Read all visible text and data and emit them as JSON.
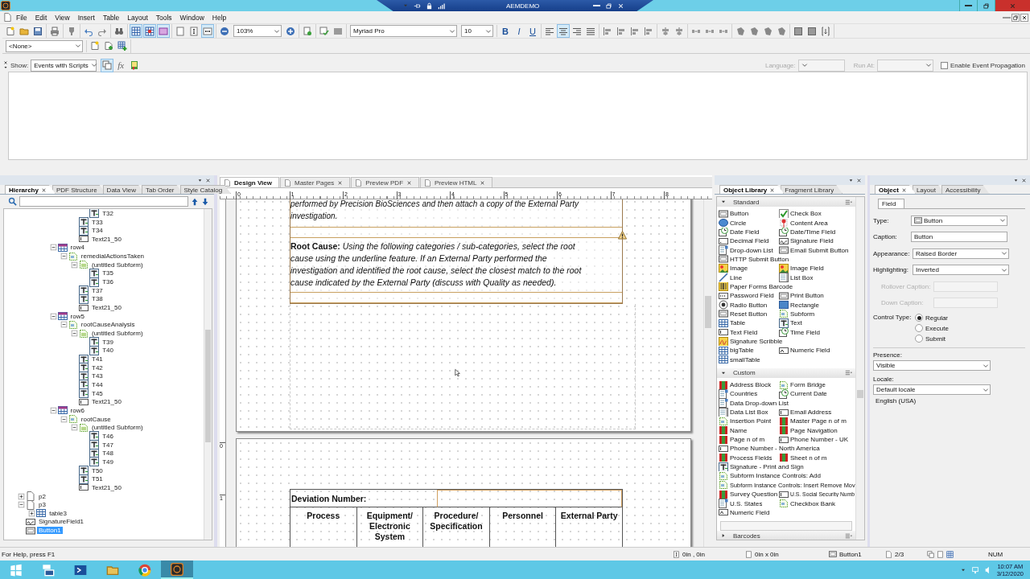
{
  "title_bar": {
    "session_label": "AEMDEMO"
  },
  "menu": [
    "File",
    "Edit",
    "View",
    "Insert",
    "Table",
    "Layout",
    "Tools",
    "Window",
    "Help"
  ],
  "toolbar": [
    [
      {
        "kind": "new",
        "pressed": false
      },
      {
        "kind": "open",
        "pressed": false
      },
      {
        "kind": "save",
        "pressed": false
      }
    ],
    [
      {
        "kind": "print",
        "pressed": false
      }
    ],
    [
      {
        "kind": "stamp",
        "pressed": false
      }
    ],
    [
      {
        "kind": "undo",
        "pressed": false
      },
      {
        "kind": "redo",
        "pressed": false
      }
    ],
    [
      {
        "kind": "find",
        "pressed": false
      }
    ],
    [
      {
        "kind": "grid",
        "pressed": true
      },
      {
        "kind": "snap",
        "pressed": true
      },
      {
        "kind": "guides",
        "pressed": true
      }
    ],
    [
      {
        "kind": "page",
        "pressed": false
      },
      {
        "kind": "vfit",
        "pressed": false
      },
      {
        "kind": "hfit",
        "pressed": true
      }
    ],
    [
      {
        "kind": "zoom-out",
        "pressed": false
      },
      {
        "kind": "zoom-select",
        "value": "103%"
      },
      {
        "kind": "zoom-in",
        "pressed": false
      }
    ],
    [
      {
        "kind": "preview",
        "pressed": false
      }
    ],
    [
      {
        "kind": "spell",
        "pressed": false
      },
      {
        "kind": "disabled-box",
        "pressed": false
      }
    ],
    [
      {
        "kind": "font-select",
        "value": "Myriad Pro"
      },
      {
        "kind": "size-select",
        "value": "10"
      }
    ],
    [
      {
        "kind": "bold",
        "label": "B",
        "pressed": false
      },
      {
        "kind": "italic",
        "label": "I",
        "pressed": false
      },
      {
        "kind": "underline",
        "label": "U",
        "pressed": false
      }
    ],
    [
      {
        "kind": "align-left",
        "pressed": false
      },
      {
        "kind": "align-center",
        "pressed": true
      },
      {
        "kind": "align-right",
        "pressed": false
      },
      {
        "kind": "justify",
        "pressed": false
      }
    ],
    [
      {
        "kind": "edge",
        "pressed": false
      },
      {
        "kind": "edge",
        "pressed": false
      },
      {
        "kind": "edge",
        "pressed": false
      },
      {
        "kind": "edge",
        "pressed": false
      }
    ],
    [
      {
        "kind": "mid",
        "pressed": false
      },
      {
        "kind": "mid",
        "pressed": false
      }
    ],
    [
      {
        "kind": "distribute",
        "pressed": false
      },
      {
        "kind": "distribute",
        "pressed": false
      },
      {
        "kind": "distribute",
        "pressed": false
      }
    ],
    [
      {
        "kind": "rotate",
        "pressed": false
      },
      {
        "kind": "rotate",
        "pressed": false
      },
      {
        "kind": "rotate",
        "pressed": false
      },
      {
        "kind": "rotate",
        "pressed": false
      }
    ],
    [
      {
        "kind": "resize",
        "pressed": false
      },
      {
        "kind": "resize",
        "pressed": false
      },
      {
        "kind": "order",
        "pressed": false
      }
    ]
  ],
  "toolbar2": [
    [
      {
        "kind": "style-select",
        "value": "<None>"
      }
    ],
    [
      {
        "kind": "form-new",
        "pressed": false
      },
      {
        "kind": "form-add",
        "pressed": false
      },
      {
        "kind": "table-add",
        "pressed": false
      }
    ]
  ],
  "script_editor": {
    "show_label": "Show:",
    "show_value": "Events with Scripts",
    "tools": [
      {
        "kind": "events",
        "pressed": true
      },
      {
        "kind": "function",
        "label": "fx",
        "pressed": false
      },
      {
        "kind": "book",
        "pressed": false
      }
    ],
    "language_label": "Language:",
    "run_at_label": "Run At:",
    "propagation": {
      "label": "Enable Event Propagation",
      "checked": false
    }
  },
  "hierarchy": {
    "tabs": [
      {
        "label": "Hierarchy",
        "selected": true
      },
      {
        "label": "PDF Structure",
        "selected": false
      },
      {
        "label": "Data View",
        "selected": false
      },
      {
        "label": "Tab Order",
        "selected": false
      },
      {
        "label": "Style Catalog",
        "selected": false
      }
    ],
    "tree": [
      {
        "children": [
          {
            "children": [
              {
                "children": [
                  {
                    "children": [
                      {
                        "children": [
                          {
                            "children": [
                              {
                                "label": "T32",
                                "kind": "text",
                                "selected": false
                              }
                            ]
                          },
                          {
                            "label": "T33",
                            "kind": "text",
                            "selected": false
                          },
                          {
                            "label": "T34",
                            "kind": "text",
                            "selected": false
                          },
                          {
                            "label": "Text21_50",
                            "kind": "textfield",
                            "selected": false
                          }
                        ]
                      }
                    ]
                  },
                  {
                    "label": "row4",
                    "kind": "row",
                    "expanded": true,
                    "selected": false,
                    "children": [
                      {
                        "label": "remedialActionsTaken",
                        "kind": "subform",
                        "expanded": true,
                        "selected": false,
                        "children": [
                          {
                            "label": "(untitled Subform)",
                            "kind": "untitled",
                            "expanded": true,
                            "selected": false,
                            "children": [
                              {
                                "label": "T35",
                                "kind": "text",
                                "selected": false
                              },
                              {
                                "label": "T36",
                                "kind": "text",
                                "selected": false
                              }
                            ]
                          },
                          {
                            "label": "T37",
                            "kind": "text",
                            "selected": false
                          },
                          {
                            "label": "T38",
                            "kind": "text",
                            "selected": false
                          },
                          {
                            "label": "Text21_50",
                            "kind": "textfield",
                            "selected": false
                          }
                        ]
                      }
                    ]
                  },
                  {
                    "label": "row5",
                    "kind": "row",
                    "expanded": true,
                    "selected": false,
                    "children": [
                      {
                        "label": "rootCauseAnalysis",
                        "kind": "subform",
                        "expanded": true,
                        "selected": false,
                        "children": [
                          {
                            "label": "(untitled Subform)",
                            "kind": "untitled",
                            "expanded": true,
                            "selected": false,
                            "children": [
                              {
                                "label": "T39",
                                "kind": "text",
                                "selected": false
                              },
                              {
                                "label": "T40",
                                "kind": "text",
                                "selected": false
                              }
                            ]
                          },
                          {
                            "label": "T41",
                            "kind": "text",
                            "selected": false
                          },
                          {
                            "label": "T42",
                            "kind": "text",
                            "selected": false
                          },
                          {
                            "label": "T43",
                            "kind": "text",
                            "selected": false
                          },
                          {
                            "label": "T44",
                            "kind": "text",
                            "selected": false
                          },
                          {
                            "label": "T45",
                            "kind": "text",
                            "selected": false
                          },
                          {
                            "label": "Text21_50",
                            "kind": "textfield",
                            "selected": false
                          }
                        ]
                      }
                    ]
                  },
                  {
                    "label": "row6",
                    "kind": "row",
                    "expanded": true,
                    "selected": false,
                    "children": [
                      {
                        "label": "rootCause",
                        "kind": "subform",
                        "expanded": true,
                        "selected": false,
                        "children": [
                          {
                            "label": "(untitled Subform)",
                            "kind": "untitled",
                            "expanded": true,
                            "selected": false,
                            "children": [
                              {
                                "label": "T46",
                                "kind": "text",
                                "selected": false
                              },
                              {
                                "label": "T47",
                                "kind": "text",
                                "selected": false
                              },
                              {
                                "label": "T48",
                                "kind": "text",
                                "selected": false
                              },
                              {
                                "label": "T49",
                                "kind": "text",
                                "selected": false
                              }
                            ]
                          },
                          {
                            "label": "T50",
                            "kind": "text",
                            "selected": false
                          },
                          {
                            "label": "T51",
                            "kind": "text",
                            "selected": false
                          },
                          {
                            "label": "Text21_50",
                            "kind": "textfield",
                            "selected": false
                          }
                        ]
                      }
                    ]
                  }
                ]
              }
            ]
          }
        ]
      },
      {
        "label": "p2",
        "kind": "page",
        "expanded": false,
        "selected": false
      },
      {
        "label": "p3",
        "kind": "page",
        "expanded": true,
        "selected": false,
        "children": [
          {
            "label": "table3",
            "kind": "table",
            "expanded": false,
            "selected": false
          }
        ]
      },
      {
        "label": "SignatureField1",
        "kind": "signature",
        "selected": false
      },
      {
        "label": "Button1",
        "kind": "button",
        "selected": true
      }
    ]
  },
  "design": {
    "tabs": [
      {
        "label": "Design View",
        "selected": true,
        "closable": false
      },
      {
        "label": "Master Pages",
        "selected": false,
        "closable": true
      },
      {
        "label": "Preview PDF",
        "selected": false,
        "closable": true
      },
      {
        "label": "Preview HTML",
        "selected": false,
        "closable": true
      }
    ],
    "ruler": [
      "0",
      "1",
      "2",
      "3",
      "4",
      "5",
      "6",
      "7",
      "8"
    ],
    "vruler": [
      "0",
      "1"
    ],
    "intro": "performed by Precision BioSciences and then attach a copy of the External Party investigation.",
    "root_cause": "**Root Cause:** Using the following categories / sub-categories, select the root cause using the underline feature. If an External Party performed the investigation and identified the root cause, select the closest match to the root cause indicated by the External Party (discuss with Quality as needed).",
    "deviation_label": "Deviation Number:",
    "columns": [
      "Process",
      "Equipment/ Electronic System",
      "Procedure/ Specification",
      "Personnel",
      "External Party"
    ]
  },
  "library": {
    "tabs": [
      {
        "label": "Object Library",
        "selected": true
      },
      {
        "label": "Fragment Library",
        "selected": false
      }
    ],
    "sections": [
      {
        "title": "Standard",
        "expanded": true,
        "rows": [
          [
            {
              "label": "Button",
              "kind": "button"
            },
            {
              "label": "Check Box",
              "kind": "check"
            }
          ],
          [
            {
              "label": "Circle",
              "kind": "circle"
            },
            {
              "label": "Content Area",
              "kind": "area"
            }
          ],
          [
            {
              "label": "Date Field",
              "kind": "date"
            },
            {
              "label": "Date/Time Field",
              "kind": "date"
            }
          ],
          [
            {
              "label": "Decimal Field",
              "kind": "decimal"
            },
            {
              "label": "Signature Field",
              "kind": "signature"
            }
          ],
          [
            {
              "label": "Drop-down List",
              "kind": "dropdown"
            },
            {
              "label": "Email Submit Button",
              "kind": "button"
            }
          ],
          [
            {
              "label": "HTTP Submit Button",
              "kind": "button"
            }
          ],
          [
            {
              "label": "Image",
              "kind": "image"
            },
            {
              "label": "Image Field",
              "kind": "image"
            }
          ],
          [
            {
              "label": "Line",
              "kind": "line"
            },
            {
              "label": "List Box",
              "kind": "list"
            }
          ],
          [
            {
              "label": "Paper Forms Barcode",
              "kind": "barcode"
            }
          ],
          [
            {
              "label": "Password Field",
              "kind": "password"
            },
            {
              "label": "Print Button",
              "kind": "button"
            }
          ],
          [
            {
              "label": "Radio Button",
              "kind": "radio"
            },
            {
              "label": "Rectangle",
              "kind": "rect"
            }
          ],
          [
            {
              "label": "Reset Button",
              "kind": "button"
            },
            {
              "label": "Subform",
              "kind": "subform"
            }
          ],
          [
            {
              "label": "Table",
              "kind": "table"
            },
            {
              "label": "Text",
              "kind": "text"
            }
          ],
          [
            {
              "label": "Text Field",
              "kind": "textfield"
            },
            {
              "label": "Time Field",
              "kind": "date"
            }
          ],
          [
            {
              "label": "Signature Scribble",
              "kind": "scribble"
            }
          ],
          [
            {
              "label": "bigTable",
              "kind": "table"
            },
            {
              "label": "Numeric Field",
              "kind": "numeric"
            }
          ],
          [
            {
              "label": "smallTable",
              "kind": "table"
            }
          ]
        ]
      },
      {
        "title": "Custom",
        "expanded": true,
        "rows": [
          [
            {
              "label": "Address Block",
              "kind": "custom"
            },
            {
              "label": "Form Bridge",
              "kind": "subform"
            }
          ],
          [
            {
              "label": "Countries",
              "kind": "dropdown"
            },
            {
              "label": "Current Date",
              "kind": "date"
            }
          ],
          [
            {
              "label": "Data Drop-down List",
              "kind": "dropdown"
            }
          ],
          [
            {
              "label": "Data List Box",
              "kind": "list"
            },
            {
              "label": "Email Address",
              "kind": "textfield"
            }
          ],
          [
            {
              "label": "Insertion Point",
              "kind": "subform"
            },
            {
              "label": "Master Page n of m",
              "kind": "custom"
            }
          ],
          [
            {
              "label": "Name",
              "kind": "custom"
            },
            {
              "label": "Page Navigation",
              "kind": "custom"
            }
          ],
          [
            {
              "label": "Page n of m",
              "kind": "custom"
            },
            {
              "label": "Phone Number - UK",
              "kind": "textfield"
            }
          ],
          [
            {
              "label": "Phone Number - North America",
              "kind": "textfield"
            }
          ],
          [
            {
              "label": "Process Fields",
              "kind": "custom"
            },
            {
              "label": "Sheet n of m",
              "kind": "custom"
            }
          ],
          [
            {
              "label": "Signature - Print and Sign",
              "kind": "text"
            }
          ],
          [
            {
              "label": "Subform Instance Controls: Add",
              "kind": "subform"
            }
          ],
          [
            {
              "label": "Subform Instance Controls: Insert Remove Mov",
              "kind": "subform"
            }
          ],
          [
            {
              "label": "Survey Question",
              "kind": "custom"
            },
            {
              "label": "U.S. Social Security Numb",
              "kind": "textfield"
            }
          ],
          [
            {
              "label": "U.S. States",
              "kind": "dropdown"
            },
            {
              "label": "Checkbox Bank",
              "kind": "subform"
            }
          ],
          [
            {
              "label": "Numeric Field",
              "kind": "numeric"
            }
          ]
        ]
      },
      {
        "title": "Barcodes",
        "expanded": false
      }
    ]
  },
  "object": {
    "tabs": [
      {
        "label": "Object",
        "selected": true
      },
      {
        "label": "Layout",
        "selected": false
      },
      {
        "label": "Accessibility",
        "selected": false
      }
    ],
    "subtabs": [
      {
        "label": "Field",
        "selected": true
      }
    ],
    "fields": [
      {
        "label": "Type:",
        "kind": "select",
        "value": "Button",
        "disabled": false
      },
      {
        "label": "Caption:",
        "kind": "text",
        "value": "Button",
        "disabled": false
      },
      {
        "label": "Appearance:",
        "kind": "select",
        "value": "Raised Border",
        "disabled": false
      },
      {
        "label": "Highlighting:",
        "kind": "select",
        "value": "Inverted",
        "disabled": false
      },
      {
        "label": "Rollover Caption:",
        "kind": "text",
        "disabled": true
      },
      {
        "label": "Down Caption:",
        "kind": "text",
        "disabled": true
      }
    ],
    "control_type": {
      "label": "Control Type:",
      "options": [
        {
          "label": "Regular",
          "selected": true
        },
        {
          "label": "Execute",
          "selected": false
        },
        {
          "label": "Submit",
          "selected": false
        }
      ]
    },
    "presence": {
      "label": "Presence:",
      "value": "Visible"
    },
    "locale": {
      "label": "Locale:",
      "value": "Default locale",
      "note": "English (USA)"
    }
  },
  "status_bar": {
    "help": "For Help, press F1",
    "position": "0in , 0in",
    "size": "0in x 0in",
    "object": "Button1",
    "page": "2/3",
    "num": "NUM"
  },
  "taskbar": {
    "apps": [
      {
        "kind": "start",
        "active": false
      },
      {
        "kind": "server",
        "active": false
      },
      {
        "kind": "shell",
        "active": false
      },
      {
        "kind": "folder",
        "active": false
      },
      {
        "kind": "browser",
        "active": false
      },
      {
        "kind": "designer",
        "active": true
      }
    ],
    "time": "10:07 AM",
    "date": "3/12/2020"
  }
}
